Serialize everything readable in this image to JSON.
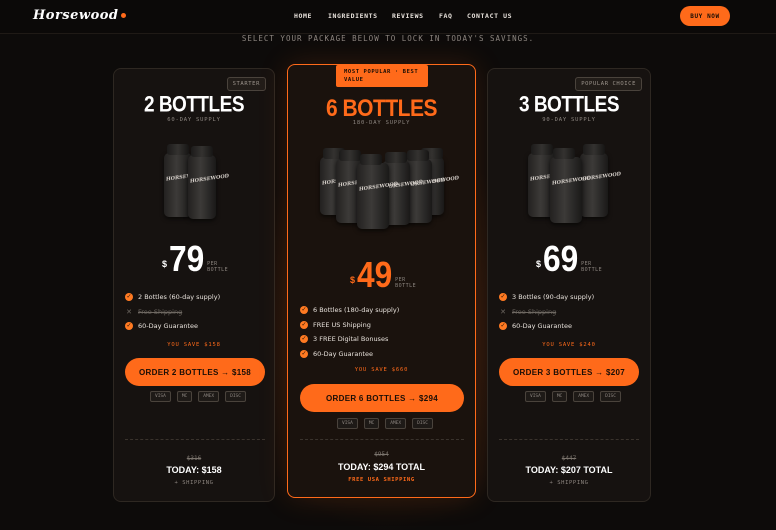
{
  "brand": {
    "logo": "Horsewood"
  },
  "nav": {
    "links": [
      "HOME",
      "INGREDIENTS",
      "REVIEWS",
      "FAQ",
      "CONTACT US"
    ],
    "buy": "BUY NOW"
  },
  "tagline": "SELECT YOUR PACKAGE BELOW TO LOCK IN TODAY'S SAVINGS.",
  "colors": {
    "accent": "#ff6a1a",
    "background": "#0d0b0a",
    "card": "#161210"
  },
  "bottle_label": "HORSEWOOD",
  "packages": [
    {
      "badge": "STARTER",
      "title": "2 BOTTLES",
      "supply": "60-DAY SUPPLY",
      "currency": "$",
      "price": "79",
      "per": "PER BOTTLE",
      "features": [
        {
          "text": "2 Bottles (60-day supply)",
          "included": true
        },
        {
          "text": "Free Shipping",
          "included": false
        },
        {
          "text": "60-Day Guarantee",
          "included": true
        }
      ],
      "save": "YOU SAVE $158",
      "button": "ORDER 2 BOTTLES → $158",
      "payments": [
        "VISA",
        "MC",
        "AMEX",
        "DISC"
      ],
      "old_price": "$316",
      "today": "TODAY: $158",
      "shipping": "+ SHIPPING"
    },
    {
      "badge": "MOST POPULAR · BEST VALUE",
      "title": "6 BOTTLES",
      "supply": "180-DAY SUPPLY",
      "currency": "$",
      "price": "49",
      "per": "PER BOTTLE",
      "features": [
        {
          "text": "6 Bottles (180-day supply)",
          "included": true
        },
        {
          "text": "FREE US Shipping",
          "included": true
        },
        {
          "text": "3 FREE Digital Bonuses",
          "included": true
        },
        {
          "text": "60-Day Guarantee",
          "included": true
        }
      ],
      "save": "YOU SAVE $660",
      "button": "ORDER 6 BOTTLES → $294",
      "payments": [
        "VISA",
        "MC",
        "AMEX",
        "DISC"
      ],
      "old_price": "$954",
      "today": "TODAY: $294 TOTAL",
      "shipping": "FREE USA SHIPPING"
    },
    {
      "badge": "POPULAR CHOICE",
      "title": "3 BOTTLES",
      "supply": "90-DAY SUPPLY",
      "currency": "$",
      "price": "69",
      "per": "PER BOTTLE",
      "features": [
        {
          "text": "3 Bottles (90-day supply)",
          "included": true
        },
        {
          "text": "Free Shipping",
          "included": false
        },
        {
          "text": "60-Day Guarantee",
          "included": true
        }
      ],
      "save": "YOU SAVE $240",
      "button": "ORDER 3 BOTTLES → $207",
      "payments": [
        "VISA",
        "MC",
        "AMEX",
        "DISC"
      ],
      "old_price": "$447",
      "today": "TODAY: $207 TOTAL",
      "shipping": "+ SHIPPING"
    }
  ]
}
